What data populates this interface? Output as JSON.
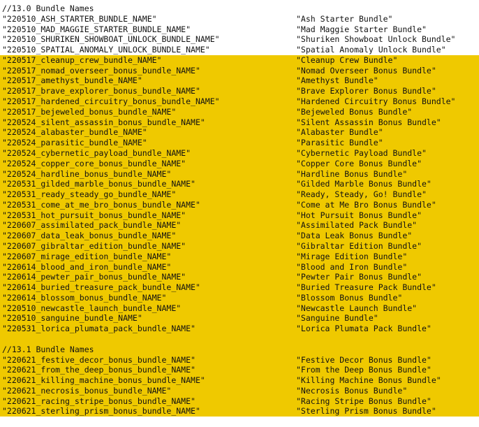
{
  "editor": {
    "background_color": "#ffffff",
    "text_color": "#111111",
    "highlight_color": "#efc900",
    "font_kind": "monospace"
  },
  "sections": [
    {
      "comment": "//13.0 Bundle Names",
      "comment_highlighted": false,
      "entries": [
        {
          "key": "\"220510_ASH_STARTER_BUNDLE_NAME\"",
          "value": "\"Ash Starter Bundle\"",
          "highlighted": false
        },
        {
          "key": "\"220510_MAD_MAGGIE_STARTER_BUNDLE_NAME\"",
          "value": "\"Mad Maggie Starter Bundle\"",
          "highlighted": false
        },
        {
          "key": "\"220510_SHURIKEN_SHOWBOAT_UNLOCK_BUNDLE_NAME\"",
          "value": "\"Shuriken Showboat Unlock Bundle\"",
          "highlighted": false
        },
        {
          "key": "\"220510_SPATIAL_ANOMALY_UNLOCK_BUNDLE_NAME\"",
          "value": "\"Spatial Anomaly Unlock Bundle\"",
          "highlighted": false
        },
        {
          "key": "\"220517_cleanup_crew_bundle_NAME\"",
          "value": "\"Cleanup Crew Bundle\"",
          "highlighted": true
        },
        {
          "key": "\"220517_nomad_overseer_bonus_bundle_NAME\"",
          "value": "\"Nomad Overseer Bonus Bundle\"",
          "highlighted": true
        },
        {
          "key": "\"220517_amethyst_bundle_NAME\"",
          "value": "\"Amethyst Bundle\"",
          "highlighted": true
        },
        {
          "key": "\"220517_brave_explorer_bonus_bundle_NAME\"",
          "value": "\"Brave Explorer Bonus Bundle\"",
          "highlighted": true
        },
        {
          "key": "\"220517_hardened_circuitry_bonus_bundle_NAME\"",
          "value": "\"Hardened Circuitry Bonus Bundle\"",
          "highlighted": true
        },
        {
          "key": "\"220517_bejeweled_bonus_bundle_NAME\"",
          "value": "\"Bejeweled Bonus Bundle\"",
          "highlighted": true
        },
        {
          "key": "\"220524_silent_assassin_bonus_bundle_NAME\"",
          "value": "\"Silent Assassin Bonus Bundle\"",
          "highlighted": true
        },
        {
          "key": "\"220524_alabaster_bundle_NAME\"",
          "value": "\"Alabaster Bundle\"",
          "highlighted": true
        },
        {
          "key": "\"220524_parasitic_bundle_NAME\"",
          "value": "\"Parasitic Bundle\"",
          "highlighted": true
        },
        {
          "key": "\"220524_cybernetic_payload_bundle_NAME\"",
          "value": "\"Cybernetic Payload Bundle\"",
          "highlighted": true
        },
        {
          "key": "\"220524_copper_core_bonus_bundle_NAME\"",
          "value": "\"Copper Core Bonus Bundle\"",
          "highlighted": true
        },
        {
          "key": "\"220524_hardline_bonus_bundle_NAME\"",
          "value": "\"Hardline Bonus Bundle\"",
          "highlighted": true
        },
        {
          "key": "\"220531_gilded_marble_bonus_bundle_NAME\"",
          "value": "\"Gilded Marble Bonus Bundle\"",
          "highlighted": true
        },
        {
          "key": "\"220531_ready_steady_go_bundle_NAME\"",
          "value": "\"Ready, Steady, Go! Bundle\"",
          "highlighted": true
        },
        {
          "key": "\"220531_come_at_me_bro_bonus_bundle_NAME\"",
          "value": "\"Come at Me Bro Bonus Bundle\"",
          "highlighted": true
        },
        {
          "key": "\"220531_hot_pursuit_bonus_bundle_NAME\"",
          "value": "\"Hot Pursuit Bonus Bundle\"",
          "highlighted": true
        },
        {
          "key": "\"220607_assimilated_pack_bundle_NAME\"",
          "value": "\"Assimilated Pack Bundle\"",
          "highlighted": true
        },
        {
          "key": "\"220607_data_leak_bonus_bundle_NAME\"",
          "value": "\"Data Leak Bonus Bundle\"",
          "highlighted": true
        },
        {
          "key": "\"220607_gibraltar_edition_bundle_NAME\"",
          "value": "\"Gibraltar Edition Bundle\"",
          "highlighted": true
        },
        {
          "key": "\"220607_mirage_edition_bundle_NAME\"",
          "value": "\"Mirage Edition Bundle\"",
          "highlighted": true
        },
        {
          "key": "\"220614_blood_and_iron_bundle_NAME\"",
          "value": "\"Blood and Iron Bundle\"",
          "highlighted": true
        },
        {
          "key": "\"220614_pewter_pair_bonus_bundle_NAME\"",
          "value": "\"Pewter Pair Bonus Bundle\"",
          "highlighted": true
        },
        {
          "key": "\"220614_buried_treasure_pack_bundle_NAME\"",
          "value": "\"Buried Treasure Pack Bundle\"",
          "highlighted": true
        },
        {
          "key": "\"220614_blossom_bonus_bundle_NAME\"",
          "value": "\"Blossom Bonus Bundle\"",
          "highlighted": true
        },
        {
          "key": "\"220510_newcastle_launch_bundle_NAME\"",
          "value": "\"Newcastle Launch Bundle\"",
          "highlighted": true
        },
        {
          "key": "\"220510_sanguine_bundle_NAME\"",
          "value": "\"Sanguine Bundle\"",
          "highlighted": true
        },
        {
          "key": "\"220531_lorica_plumata_pack_bundle_NAME\"",
          "value": "\"Lorica Plumata Pack Bundle\"",
          "highlighted": true
        }
      ]
    },
    {
      "comment": "//13.1 Bundle Names",
      "comment_highlighted": true,
      "entries": [
        {
          "key": "\"220621_festive_decor_bonus_bundle_NAME\"",
          "value": "\"Festive Decor Bonus Bundle\"",
          "highlighted": true
        },
        {
          "key": "\"220621_from_the_deep_bonus_bundle_NAME\"",
          "value": "\"From the Deep Bonus Bundle\"",
          "highlighted": true
        },
        {
          "key": "\"220621_killing_machine_bonus_bundle_NAME\"",
          "value": "\"Killing Machine Bonus Bundle\"",
          "highlighted": true
        },
        {
          "key": "\"220621_necrosis_bonus_bundle_NAME\"",
          "value": "\"Necrosis Bonus Bundle\"",
          "highlighted": true
        },
        {
          "key": "\"220621_racing_stripe_bonus_bundle_NAME\"",
          "value": "\"Racing Stripe Bonus Bundle\"",
          "highlighted": true
        },
        {
          "key": "\"220621_sterling_prism_bonus_bundle_NAME\"",
          "value": "\"Sterling Prism Bonus Bundle\"",
          "highlighted": true
        }
      ]
    }
  ],
  "separator_blank_lines": 1
}
